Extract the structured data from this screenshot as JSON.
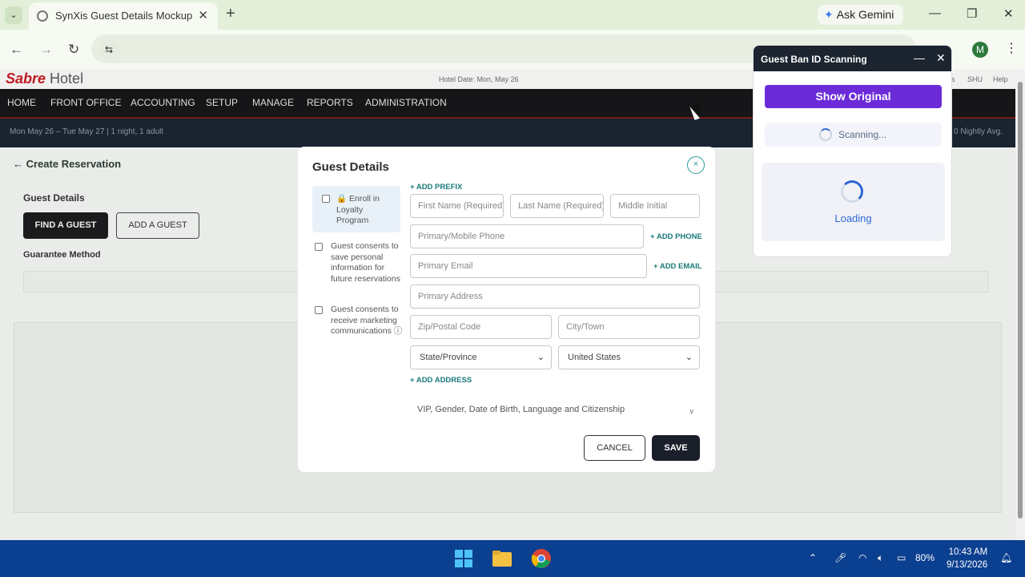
{
  "browser": {
    "tab_title": "SynXis Guest Details Mockup",
    "tab_close": "✕",
    "new_tab": "+",
    "ask_gemini": "Ask Gemini",
    "minimize": "—",
    "restore": "❐",
    "close": "✕",
    "back": "←",
    "forward": "→",
    "reload": "↻",
    "site_info": "⇆",
    "profile_initial": "M",
    "menu": "⋮"
  },
  "app": {
    "brand_sabre": "Sabre",
    "brand_hotel": "Hotel",
    "hotel_date": "Hotel Date: Mon, May 26",
    "head_links": [
      "s",
      "SHU",
      "Help"
    ],
    "nav": [
      "HOME",
      "FRONT OFFICE",
      "ACCOUNTING",
      "SETUP",
      "MANAGE",
      "REPORTS",
      "ADMINISTRATION"
    ],
    "stay_summary": "Mon May 26 – Tue May 27 | 1 night, 1 adult",
    "nightly_avg": "0 Nightly Avg.",
    "page_title": "← Create Reservation",
    "guest_details_label": "Guest Details",
    "find_guest": "FIND A GUEST",
    "add_guest": "ADD A GUEST",
    "guarantee_label": "Guarantee Method"
  },
  "modal": {
    "title": "Guest Details",
    "close": "×",
    "loyalty": "🔒 Enroll in Loyalty Program",
    "consent_save": "Guest consents to save personal information for future reservations",
    "consent_marketing": "Guest consents to receive marketing communications ⓘ",
    "add_prefix": "+ ADD PREFIX",
    "first_name": "First Name (Required)",
    "last_name": "Last Name (Required)",
    "middle_initial": "Middle Initial",
    "phone": "Primary/Mobile Phone",
    "add_phone": "+ ADD PHONE",
    "email": "Primary Email",
    "add_email": "+ ADD EMAIL",
    "address": "Primary Address",
    "zip": "Zip/Postal Code",
    "city": "City/Town",
    "state": "State/Province",
    "country": "United States",
    "add_address": "+ ADD ADDRESS",
    "more": "VIP, Gender, Date of Birth, Language and Citizenship",
    "more_chev": "v",
    "cancel": "CANCEL",
    "save": "SAVE"
  },
  "ban_panel": {
    "title": "Guest Ban ID Scanning",
    "minimize": "—",
    "close": "✕",
    "show_original": "Show Original",
    "scanning": "Scanning...",
    "loading": "Loading"
  },
  "taskbar": {
    "battery": "80%",
    "time": "10:43 AM",
    "date": "9/13/2026"
  },
  "colors": {
    "brand_red": "#c01a20",
    "accent_teal": "#1a7a7a",
    "scan_purple": "#6c2bd9",
    "loading_blue": "#2f66d0"
  }
}
